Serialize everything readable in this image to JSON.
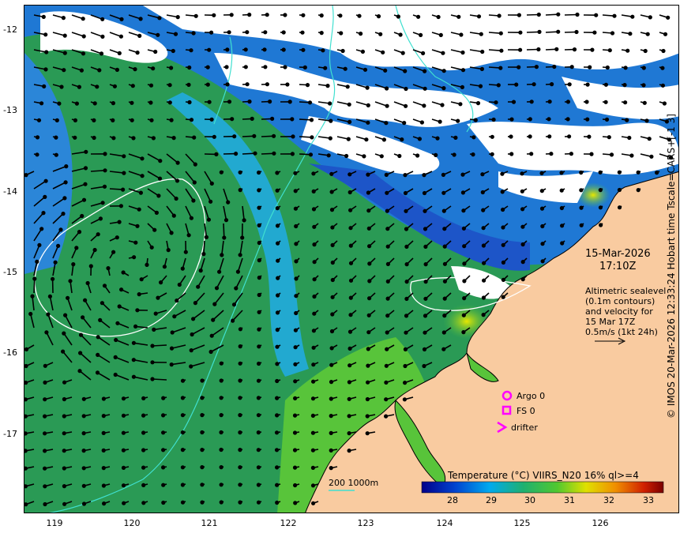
{
  "map": {
    "lat_labels": [
      "-12",
      "-13",
      "-14",
      "-15",
      "-16",
      "-17"
    ],
    "lon_labels": [
      "119",
      "120",
      "121",
      "122",
      "123",
      "124",
      "125",
      "126"
    ]
  },
  "annotation": {
    "date": "15-Mar-2026",
    "time": "17:10Z",
    "desc_lines": [
      "Altimetric sealevel",
      "(0.1m contours)",
      "and velocity for",
      "15 Mar 17Z",
      "0.5m/s (1kt 24h)"
    ]
  },
  "legend": {
    "argo": "Argo 0",
    "fs": "FS 0",
    "drifter": "drifter",
    "bathy": "200  1000m",
    "marker_color": "#ff00ff",
    "contour_color": "#40e0d0"
  },
  "colorbar": {
    "title": "Temperature (°C) VIIRS_N20 16% ql>=4",
    "ticks": [
      "28",
      "29",
      "30",
      "31",
      "32",
      "33"
    ]
  },
  "side_caption": "© IMOS 20-Mar-2026 12:33:24 Hobart time Tscale=CARS+[-1 3]",
  "colors": {
    "land": "#f9cba0",
    "sea_green": "#2a9a55",
    "sea_blue": "#1f78d4",
    "cloud": "#ffffff"
  }
}
